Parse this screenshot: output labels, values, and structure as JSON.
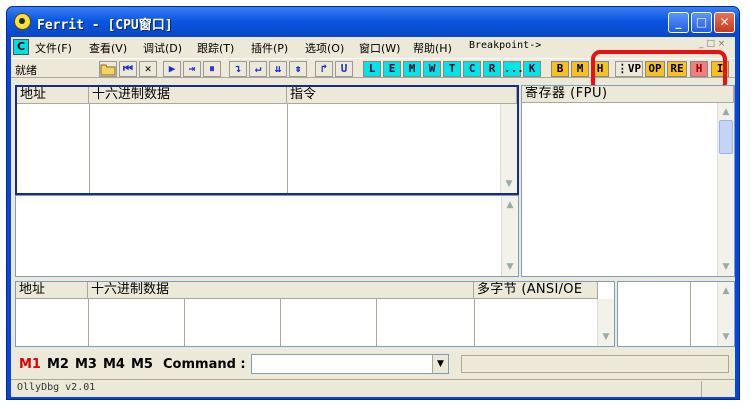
{
  "window": {
    "title": "Ferrit - [CPU窗口]",
    "minimize_glyph": "_",
    "maximize_glyph": "□",
    "close_glyph": "✕"
  },
  "menu": {
    "icon_label": "C",
    "items": [
      "文件(F)",
      "查看(V)",
      "调试(D)",
      "跟踪(T)",
      "插件(P)",
      "选项(O)",
      "窗口(W)",
      "帮助(H)",
      "Breakpoint->"
    ],
    "mdi_controls": "_ □ ×"
  },
  "toolbar": {
    "status": "就绪",
    "nav_buttons": [
      "⏮",
      "✕",
      "▶",
      "⇥",
      "⏸"
    ],
    "step_buttons": [
      "↴",
      "↵",
      "⇊",
      "⇟",
      "↱",
      "U"
    ],
    "cyan_buttons": [
      "L",
      "E",
      "M",
      "W",
      "T",
      "C",
      "R",
      "...",
      "K"
    ],
    "yellow_buttons": [
      "B",
      "M",
      "H"
    ],
    "extra_buttons": [
      "⋮VP",
      "OP",
      "RE",
      "H",
      "I"
    ]
  },
  "disasm": {
    "col_address": "地址",
    "col_hex": "十六进制数据",
    "col_instruction": "指令"
  },
  "registers": {
    "title": "寄存器 (FPU)"
  },
  "dump": {
    "col_address": "地址",
    "col_hex": "十六进制数据",
    "col_text": "多字节 (ANSI/OE"
  },
  "command": {
    "tabs": [
      "M1",
      "M2",
      "M3",
      "M4",
      "M5"
    ],
    "label": "Command :",
    "value": "",
    "dropdown_glyph": "▼"
  },
  "statusbar": {
    "text": "OllyDbg v2.01"
  },
  "colors": {
    "accent": "#e81010",
    "titlebar": "#0a57e0",
    "active_tab": "#e00000"
  }
}
